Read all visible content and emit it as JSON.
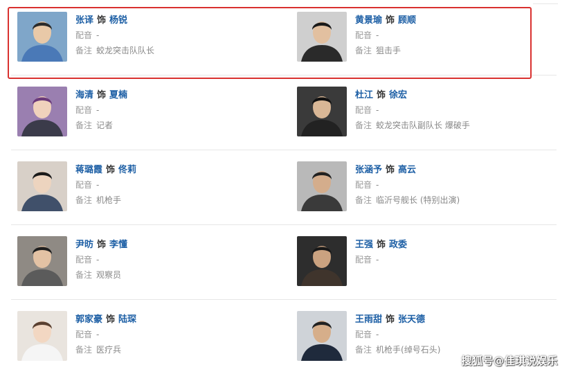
{
  "link_color": "#1d5fa5",
  "highlight_color": "#d9312f",
  "separator_word": "饰",
  "dub_label": "配音",
  "note_label": "备注",
  "cast_rows": [
    [
      {
        "actor": "张译",
        "role": "杨锐",
        "dub": "-",
        "note": "蛟龙突击队队长",
        "photo_icon": "avatar-icon"
      },
      {
        "actor": "黄景瑜",
        "role": "顾顺",
        "dub": "-",
        "note": "狙击手",
        "photo_icon": "avatar-icon"
      }
    ],
    [
      {
        "actor": "海清",
        "role": "夏楠",
        "dub": "-",
        "note": "记者",
        "photo_icon": "avatar-icon"
      },
      {
        "actor": "杜江",
        "role": "徐宏",
        "dub": "-",
        "note": "蛟龙突击队副队长 爆破手",
        "photo_icon": "avatar-icon"
      }
    ],
    [
      {
        "actor": "蒋璐霞",
        "role": "佟莉",
        "dub": "-",
        "note": "机枪手",
        "photo_icon": "avatar-icon"
      },
      {
        "actor": "张涵予",
        "role": "高云",
        "dub": "-",
        "note": "临沂号舰长 (特别出演)",
        "photo_icon": "avatar-icon"
      }
    ],
    [
      {
        "actor": "尹昉",
        "role": "李懂",
        "dub": "-",
        "note": "观察员",
        "photo_icon": "avatar-icon"
      },
      {
        "actor": "王强",
        "role": "政委",
        "dub": "-",
        "note": "",
        "photo_icon": "avatar-icon"
      }
    ],
    [
      {
        "actor": "郭家豪",
        "role": "陆琛",
        "dub": "-",
        "note": "医疗兵",
        "photo_icon": "avatar-icon"
      },
      {
        "actor": "王雨甜",
        "role": "张天德",
        "dub": "-",
        "note": "机枪手(绰号石头)",
        "photo_icon": "avatar-icon"
      }
    ]
  ],
  "watermark": "搜狐号@佳琪说娱乐"
}
